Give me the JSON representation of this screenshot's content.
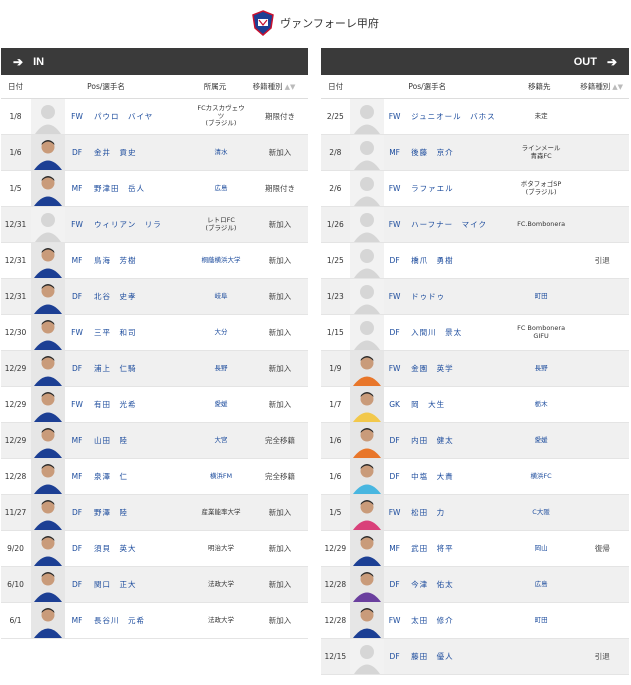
{
  "club": {
    "name": "ヴァンフォーレ甲府"
  },
  "in_panel": {
    "title": "IN",
    "columns": {
      "date": "日付",
      "pos_name": "Pos/選手名",
      "club": "所属元",
      "type": "移籍種別"
    },
    "rows": [
      {
        "date": "1/8",
        "pos": "FW",
        "name": "パウロ　バイヤ",
        "club": "FCカスカヴェウ\nツ\n(ブラジル)",
        "type": "期限付き",
        "photo": "none",
        "club_link": false
      },
      {
        "date": "1/6",
        "pos": "DF",
        "name": "金井　貢史",
        "club": "清水",
        "type": "新加入",
        "photo": "kofu",
        "club_link": true
      },
      {
        "date": "1/5",
        "pos": "MF",
        "name": "野津田　岳人",
        "club": "広島",
        "type": "期限付き",
        "photo": "kofu",
        "club_link": true
      },
      {
        "date": "12/31",
        "pos": "FW",
        "name": "ウィリアン　リラ",
        "club": "レトロFC\n(ブラジル)",
        "type": "新加入",
        "photo": "none",
        "club_link": false
      },
      {
        "date": "12/31",
        "pos": "MF",
        "name": "鳥海　芳樹",
        "club": "桐蔭横浜大学",
        "type": "新加入",
        "photo": "kofu",
        "club_link": true
      },
      {
        "date": "12/31",
        "pos": "DF",
        "name": "北谷　史孝",
        "club": "岐阜",
        "type": "新加入",
        "photo": "kofu",
        "club_link": true
      },
      {
        "date": "12/30",
        "pos": "FW",
        "name": "三平　和司",
        "club": "大分",
        "type": "新加入",
        "photo": "kofu",
        "club_link": true
      },
      {
        "date": "12/29",
        "pos": "DF",
        "name": "浦上　仁騎",
        "club": "長野",
        "type": "新加入",
        "photo": "kofu",
        "club_link": true
      },
      {
        "date": "12/29",
        "pos": "FW",
        "name": "有田　光希",
        "club": "愛媛",
        "type": "新加入",
        "photo": "kofu",
        "club_link": true
      },
      {
        "date": "12/29",
        "pos": "MF",
        "name": "山田　陸",
        "club": "大宮",
        "type": "完全移籍",
        "photo": "kofu",
        "club_link": true
      },
      {
        "date": "12/28",
        "pos": "MF",
        "name": "泉澤　仁",
        "club": "横浜FM",
        "type": "完全移籍",
        "photo": "kofu",
        "club_link": true
      },
      {
        "date": "11/27",
        "pos": "DF",
        "name": "野澤　陸",
        "club": "産業能率大学",
        "type": "新加入",
        "photo": "kofu",
        "club_link": false
      },
      {
        "date": "9/20",
        "pos": "DF",
        "name": "須貝　英大",
        "club": "明治大学",
        "type": "新加入",
        "photo": "kofu",
        "club_link": false
      },
      {
        "date": "6/10",
        "pos": "DF",
        "name": "関口　正大",
        "club": "法政大学",
        "type": "新加入",
        "photo": "kofu",
        "club_link": false
      },
      {
        "date": "6/1",
        "pos": "MF",
        "name": "長谷川　元希",
        "club": "法政大学",
        "type": "新加入",
        "photo": "kofu",
        "club_link": false
      }
    ]
  },
  "out_panel": {
    "title": "OUT",
    "columns": {
      "date": "日付",
      "pos_name": "Pos/選手名",
      "club": "移籍先",
      "type": "移籍種別"
    },
    "rows": [
      {
        "date": "2/25",
        "pos": "FW",
        "name": "ジュニオール　バホス",
        "club": "未定",
        "type": "",
        "photo": "none",
        "club_link": false
      },
      {
        "date": "2/8",
        "pos": "MF",
        "name": "後藤　京介",
        "club": "ラインメール\n青森FC",
        "type": "",
        "photo": "none",
        "club_link": false
      },
      {
        "date": "2/6",
        "pos": "FW",
        "name": "ラファエル",
        "club": "ボタフォゴSP\n(ブラジル)",
        "type": "",
        "photo": "none",
        "club_link": false
      },
      {
        "date": "1/26",
        "pos": "FW",
        "name": "ハーフナー　マイク",
        "club": "FC.Bombonera",
        "type": "",
        "photo": "none",
        "club_link": false
      },
      {
        "date": "1/25",
        "pos": "DF",
        "name": "橋爪　勇樹",
        "club": "",
        "type": "引退",
        "photo": "none",
        "club_link": false
      },
      {
        "date": "1/23",
        "pos": "FW",
        "name": "ドゥドゥ",
        "club": "町田",
        "type": "",
        "photo": "none",
        "club_link": true
      },
      {
        "date": "1/15",
        "pos": "DF",
        "name": "入間川　景太",
        "club": "FC Bombonera\nGIFU",
        "type": "",
        "photo": "none",
        "club_link": false
      },
      {
        "date": "1/9",
        "pos": "FW",
        "name": "金園　英学",
        "club": "長野",
        "type": "",
        "photo": "orange",
        "club_link": true
      },
      {
        "date": "1/7",
        "pos": "GK",
        "name": "岡　大生",
        "club": "栃木",
        "type": "",
        "photo": "yellow",
        "club_link": true
      },
      {
        "date": "1/6",
        "pos": "DF",
        "name": "内田　健太",
        "club": "愛媛",
        "type": "",
        "photo": "orange",
        "club_link": true
      },
      {
        "date": "1/6",
        "pos": "DF",
        "name": "中塩　大貴",
        "club": "横浜FC",
        "type": "",
        "photo": "cyan",
        "club_link": true
      },
      {
        "date": "1/5",
        "pos": "FW",
        "name": "松田　力",
        "club": "C大阪",
        "type": "",
        "photo": "pink",
        "club_link": true
      },
      {
        "date": "12/29",
        "pos": "MF",
        "name": "武田　将平",
        "club": "岡山",
        "type": "復帰",
        "photo": "kofu",
        "club_link": true
      },
      {
        "date": "12/28",
        "pos": "DF",
        "name": "今津　佑太",
        "club": "広島",
        "type": "",
        "photo": "purple",
        "club_link": true
      },
      {
        "date": "12/28",
        "pos": "FW",
        "name": "太田　修介",
        "club": "町田",
        "type": "",
        "photo": "kofu",
        "club_link": true
      },
      {
        "date": "12/15",
        "pos": "DF",
        "name": "藤田　優人",
        "club": "",
        "type": "引退",
        "photo": "none",
        "club_link": false
      }
    ]
  },
  "photo_colors": {
    "kofu": "#1c3f94",
    "orange": "#e8762a",
    "yellow": "#f2c84b",
    "cyan": "#48b6e0",
    "pink": "#d9407a",
    "purple": "#6a3f9e"
  }
}
